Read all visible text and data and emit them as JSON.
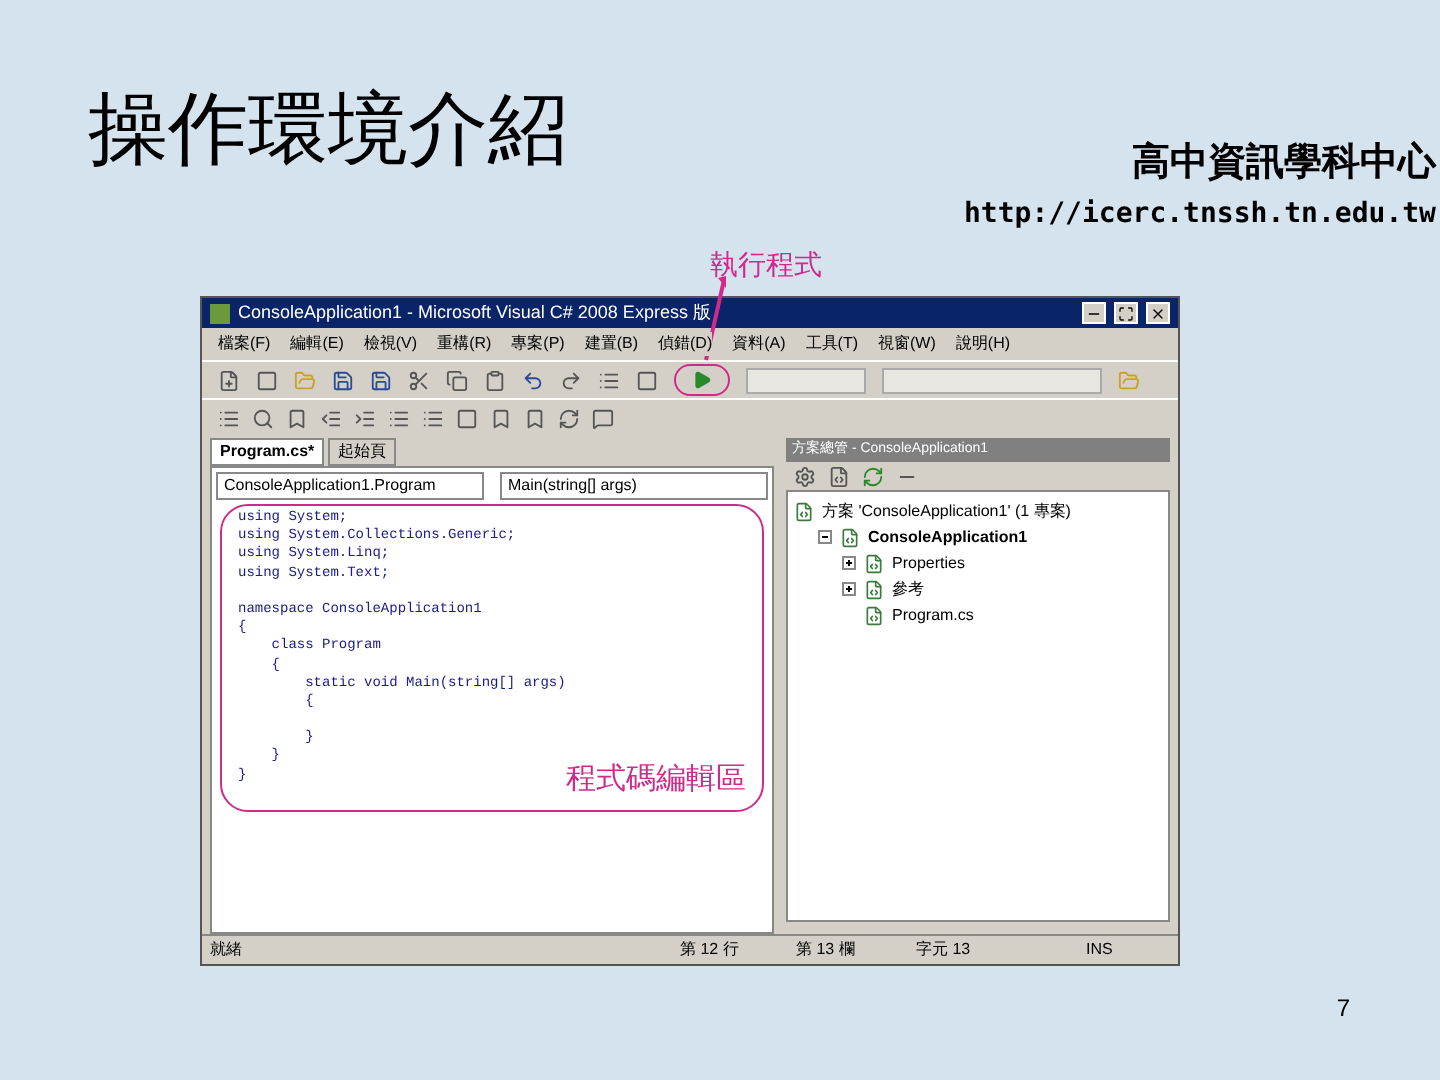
{
  "slide": {
    "title": "操作環境介紹",
    "logo_text": "高中資訊學科中心",
    "logo_url": "http://icerc.tnssh.tn.edu.tw",
    "run_callout": "執行程式",
    "editor_callout": "程式碼編輯區",
    "page_number": "7"
  },
  "window": {
    "title": "ConsoleApplication1 - Microsoft Visual C# 2008 Express 版"
  },
  "menu": [
    "檔案(F)",
    "編輯(E)",
    "檢視(V)",
    "重構(R)",
    "專案(P)",
    "建置(B)",
    "偵錯(D)",
    "資料(A)",
    "工具(T)",
    "視窗(W)",
    "說明(H)"
  ],
  "tabs": [
    {
      "label": "Program.cs*",
      "selected": true
    },
    {
      "label": "起始頁",
      "selected": false
    }
  ],
  "editor": {
    "class_dropdown": "ConsoleApplication1.Program",
    "member_dropdown": "Main(string[] args)",
    "lines": [
      {
        "text": "using System;"
      },
      {
        "text": "using System.Collections.Generic;"
      },
      {
        "text": "using System.Linq;"
      },
      {
        "text": "using System.Text;"
      },
      {
        "text": "namespace ConsoleApplication1",
        "gap_before": true
      },
      {
        "text": "{"
      },
      {
        "text": "    class Program"
      },
      {
        "text": "    {"
      },
      {
        "text": "        static void Main(string[] args)"
      },
      {
        "text": "        {"
      },
      {
        "text": "        }",
        "gap_before": true
      },
      {
        "text": "    }"
      },
      {
        "text": "}"
      }
    ]
  },
  "solution_explorer": {
    "title": "方案總管 - ConsoleApplication1",
    "tree": [
      {
        "label": "方案 'ConsoleApplication1' (1 專案)",
        "children": [
          {
            "label": "ConsoleApplication1",
            "expanded": true,
            "children": [
              {
                "label": "Properties",
                "expanded": false
              },
              {
                "label": "參考",
                "expanded": false
              },
              {
                "label": "Program.cs"
              }
            ]
          }
        ]
      }
    ]
  },
  "status_bar": [
    "就緒",
    "第 12 行",
    "第 13 欄",
    "字元 13",
    "INS"
  ]
}
